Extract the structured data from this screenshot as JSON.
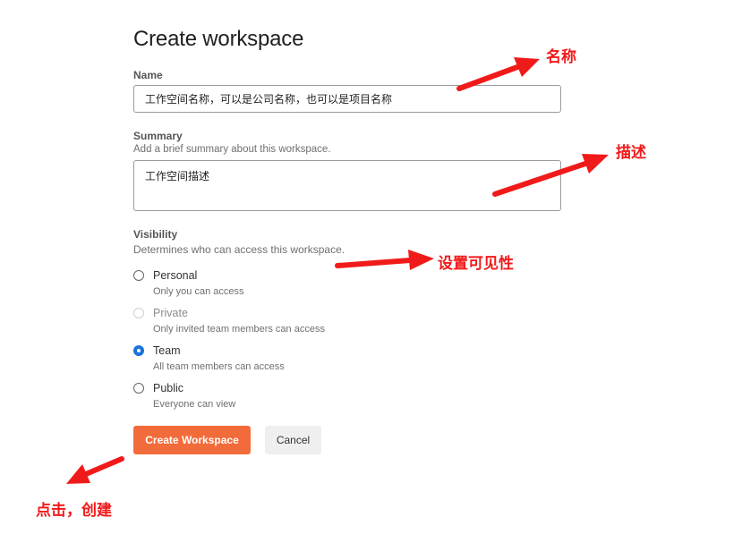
{
  "page": {
    "title": "Create workspace"
  },
  "name_field": {
    "label": "Name",
    "value": "工作空间名称，可以是公司名称，也可以是项目名称"
  },
  "summary_field": {
    "label": "Summary",
    "hint": "Add a brief summary about this workspace.",
    "value": "工作空间描述"
  },
  "visibility": {
    "label": "Visibility",
    "hint": "Determines who can access this workspace.",
    "options": [
      {
        "label": "Personal",
        "description": "Only you can access",
        "state": "unchecked"
      },
      {
        "label": "Private",
        "description": "Only invited team members can access",
        "state": "disabled"
      },
      {
        "label": "Team",
        "description": "All team members can access",
        "state": "checked"
      },
      {
        "label": "Public",
        "description": "Everyone can view",
        "state": "unchecked"
      }
    ]
  },
  "actions": {
    "create_label": "Create Workspace",
    "cancel_label": "Cancel"
  },
  "annotations": {
    "name_note": "名称",
    "summary_note": "描述",
    "visibility_note": "设置可见性",
    "create_note": "点击，创建",
    "color": "#f11a1a"
  },
  "colors": {
    "primary_button": "#f26b3a",
    "radio_checked": "#1a73d9"
  }
}
